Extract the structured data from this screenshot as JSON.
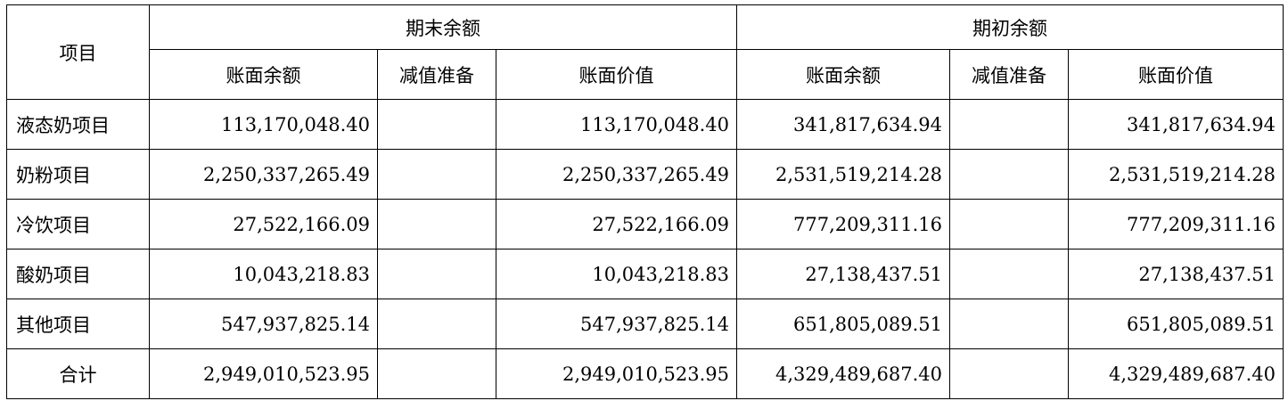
{
  "header": {
    "item_label": "项目",
    "group_end": "期末余额",
    "group_begin": "期初余额",
    "sub_columns": [
      "账面余额",
      "减值准备",
      "账面价值",
      "账面余额",
      "减值准备",
      "账面价值"
    ]
  },
  "rows": [
    {
      "item": "液态奶项目",
      "end_book_balance": "113,170,048.40",
      "end_impairment": "",
      "end_book_value": "113,170,048.40",
      "begin_book_balance": "341,817,634.94",
      "begin_impairment": "",
      "begin_book_value": "341,817,634.94"
    },
    {
      "item": "奶粉项目",
      "end_book_balance": "2,250,337,265.49",
      "end_impairment": "",
      "end_book_value": "2,250,337,265.49",
      "begin_book_balance": "2,531,519,214.28",
      "begin_impairment": "",
      "begin_book_value": "2,531,519,214.28"
    },
    {
      "item": "冷饮项目",
      "end_book_balance": "27,522,166.09",
      "end_impairment": "",
      "end_book_value": "27,522,166.09",
      "begin_book_balance": "777,209,311.16",
      "begin_impairment": "",
      "begin_book_value": "777,209,311.16"
    },
    {
      "item": "酸奶项目",
      "end_book_balance": "10,043,218.83",
      "end_impairment": "",
      "end_book_value": "10,043,218.83",
      "begin_book_balance": "27,138,437.51",
      "begin_impairment": "",
      "begin_book_value": "27,138,437.51"
    },
    {
      "item": "其他项目",
      "end_book_balance": "547,937,825.14",
      "end_impairment": "",
      "end_book_value": "547,937,825.14",
      "begin_book_balance": "651,805,089.51",
      "begin_impairment": "",
      "begin_book_value": "651,805,089.51"
    }
  ],
  "total": {
    "item": "合计",
    "end_book_balance": "2,949,010,523.95",
    "end_impairment": "",
    "end_book_value": "2,949,010,523.95",
    "begin_book_balance": "4,329,489,687.40",
    "begin_impairment": "",
    "begin_book_value": "4,329,489,687.40"
  }
}
